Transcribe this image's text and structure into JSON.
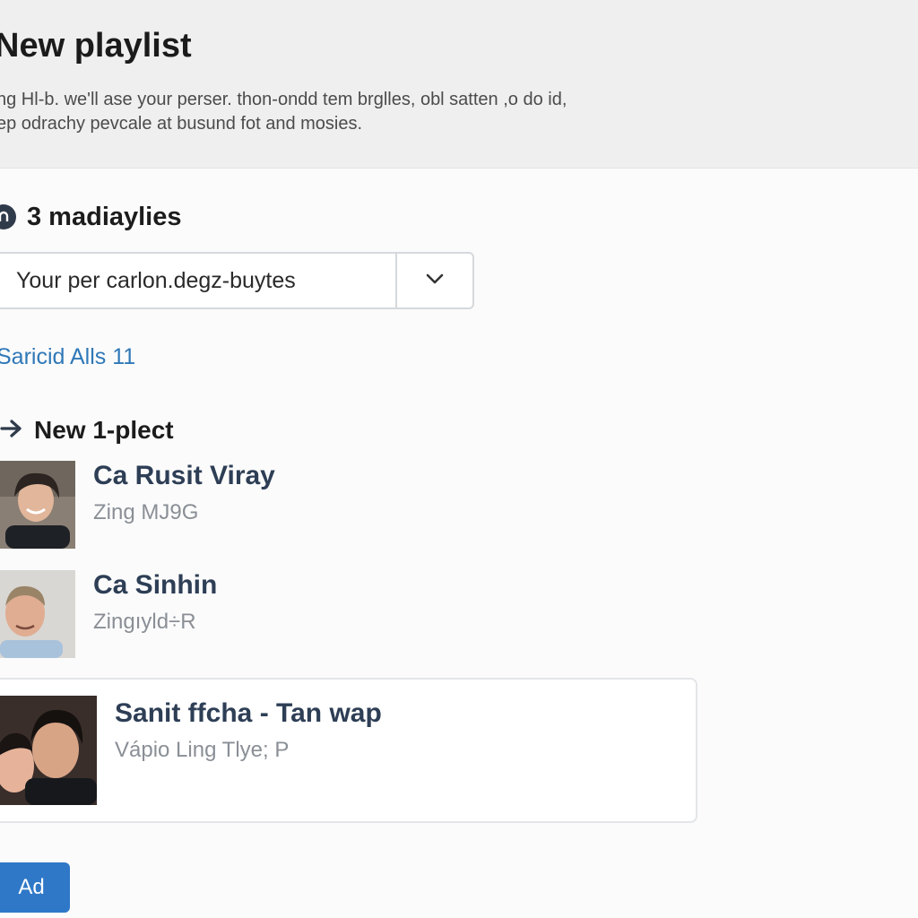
{
  "header": {
    "title": "New playlist",
    "description_line1": "ng Hl-b. we'll ase your perser. thon-ondd tem brglles, obl satten ,o do id,",
    "description_line2": "ep odrachy pevcale at busund fot and mosies."
  },
  "section": {
    "icon": "playlist-icon",
    "title": "3 madiaylies",
    "select": {
      "value": "Your per carlon.degz-buytes",
      "icon": "chevron-down-icon"
    },
    "link": "Saricid Alls 11"
  },
  "subsection": {
    "icon": "arrow-right-icon",
    "title": "New 1-plect"
  },
  "tracks": [
    {
      "name": "Ca Rusit Viray",
      "subtitle": "Zing MJ9G"
    },
    {
      "name": "Ca Sinhin",
      "subtitle": "Zingıyld÷R"
    },
    {
      "name": "Sanit ffcha - Tan wap",
      "subtitle": "Vápio Ling Tlye; P"
    }
  ],
  "actions": {
    "add_label": "Ad"
  },
  "colors": {
    "accent": "#2f78c8",
    "link": "#2f78b8",
    "track_title": "#2d3e55",
    "header_bg": "#efefef"
  }
}
